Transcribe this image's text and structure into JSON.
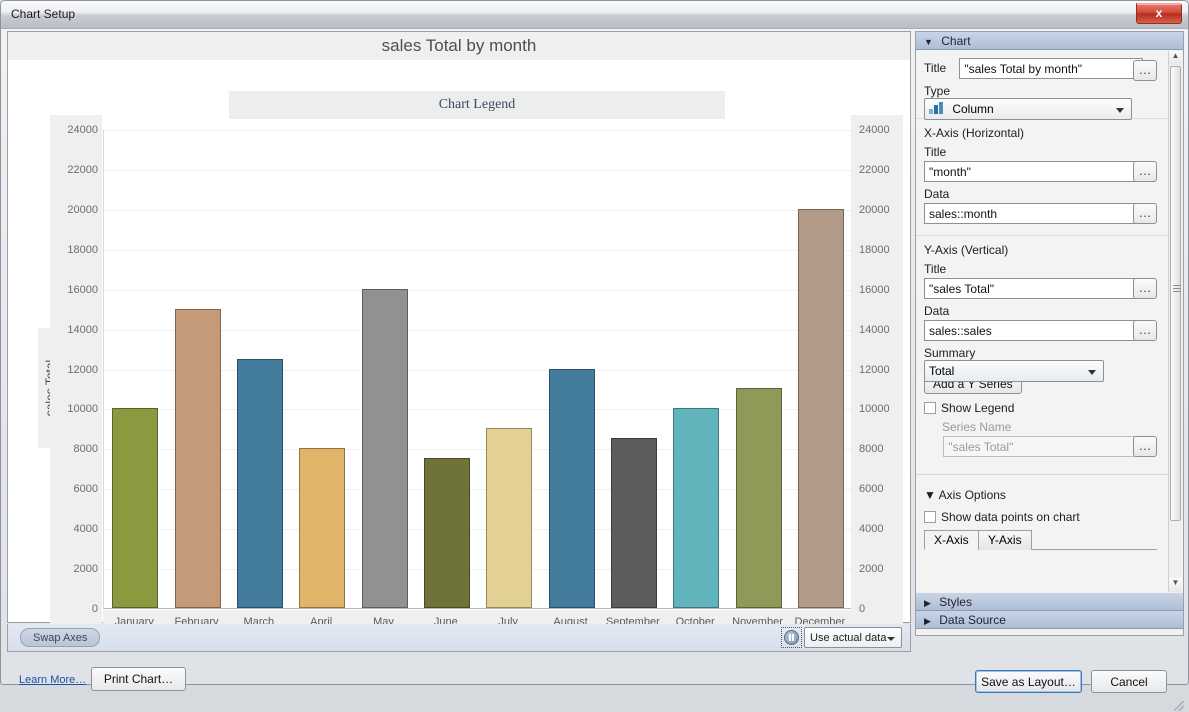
{
  "window": {
    "title": "Chart Setup",
    "close_label": "x"
  },
  "chart_preview": {
    "title": "sales Total by month",
    "legend_label": "Chart Legend",
    "y_axis_title": "sales Total",
    "x_axis_title": "month"
  },
  "chart_data": {
    "type": "bar",
    "title": "sales Total by month",
    "xlabel": "month",
    "ylabel": "sales Total",
    "ylim": [
      0,
      24000
    ],
    "ytick_labels": [
      "24000",
      "22000",
      "20000",
      "18000",
      "16000",
      "14000",
      "12000",
      "10000",
      "8000",
      "6000",
      "4000",
      "2000",
      "0"
    ],
    "yticks": [
      24000,
      22000,
      20000,
      18000,
      16000,
      14000,
      12000,
      10000,
      8000,
      6000,
      4000,
      2000,
      0
    ],
    "grid": true,
    "legend": "Chart Legend",
    "legend_position": "top",
    "dual_y_axis": true,
    "categories": [
      "January",
      "February",
      "March",
      "April",
      "May",
      "June",
      "July",
      "August",
      "September",
      "October",
      "November",
      "December"
    ],
    "values": [
      10000,
      15000,
      12500,
      8000,
      16000,
      7500,
      9000,
      12000,
      8500,
      10000,
      11000,
      20000
    ],
    "colors": [
      "#8b9a3f",
      "#c49a79",
      "#447c9e",
      "#e0b469",
      "#919191",
      "#6f7239",
      "#e2d192",
      "#447c9e",
      "#5c5c5c",
      "#61b4bb",
      "#8f9a58",
      "#b29c89"
    ],
    "series": [
      {
        "name": "sales Total",
        "values": [
          10000,
          15000,
          12500,
          8000,
          16000,
          7500,
          9000,
          12000,
          8500,
          10000,
          11000,
          20000
        ]
      }
    ]
  },
  "toolbar": {
    "swap_axes": "Swap Axes",
    "data_mode": "Use actual data",
    "pause_icon": "pause-icon"
  },
  "footer": {
    "learn_more": "Learn More…",
    "print_chart": "Print Chart…",
    "save_as_layout": "Save as Layout…",
    "cancel": "Cancel"
  },
  "inspector": {
    "chart_section": {
      "header": "Chart",
      "title_label": "Title",
      "title_value": "\"sales Total by month\"",
      "type_label": "Type",
      "type_value": "Column",
      "ellipsis": "…"
    },
    "x_axis": {
      "group_label": "X-Axis (Horizontal)",
      "title_label": "Title",
      "title_value": "\"month\"",
      "data_label": "Data",
      "data_value": "sales::month"
    },
    "y_axis": {
      "group_label": "Y-Axis (Vertical)",
      "title_label": "Title",
      "title_value": "\"sales Total\"",
      "data_label": "Data",
      "data_value": "sales::sales",
      "summary_label": "Summary",
      "summary_value": "Total",
      "add_series_button": "Add a Y Series",
      "show_legend_label": "Show Legend",
      "series_name_label": "Series Name",
      "series_name_value": "\"sales Total\""
    },
    "axis_options": {
      "header": "Axis Options",
      "show_data_points_label": "Show data points on chart",
      "tabs": [
        "X-Axis",
        "Y-Axis"
      ]
    },
    "styles_header": "Styles",
    "data_source_header": "Data Source"
  }
}
